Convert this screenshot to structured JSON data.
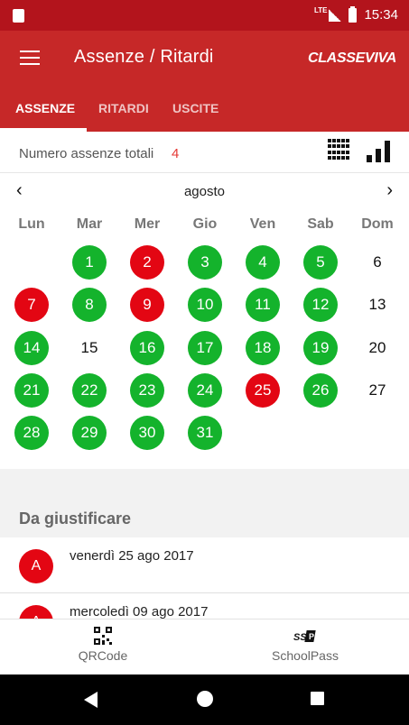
{
  "status_bar": {
    "network": "LTE",
    "time": "15:34"
  },
  "app_bar": {
    "title": "Assenze / Ritardi",
    "logo": "CLASSEVIVA"
  },
  "tabs": [
    {
      "label": "ASSENZE",
      "active": true
    },
    {
      "label": "RITARDI",
      "active": false
    },
    {
      "label": "USCITE",
      "active": false
    }
  ],
  "totals": {
    "label": "Numero assenze totali",
    "count": "4"
  },
  "calendar": {
    "month": "agosto",
    "weekdays": [
      "Lun",
      "Mar",
      "Mer",
      "Gio",
      "Ven",
      "Sab",
      "Dom"
    ],
    "days": [
      {
        "n": "1",
        "status": "green"
      },
      {
        "n": "2",
        "status": "red"
      },
      {
        "n": "3",
        "status": "green"
      },
      {
        "n": "4",
        "status": "green"
      },
      {
        "n": "5",
        "status": "green"
      },
      {
        "n": "6",
        "status": "none"
      },
      {
        "n": "7",
        "status": "red"
      },
      {
        "n": "8",
        "status": "green"
      },
      {
        "n": "9",
        "status": "red"
      },
      {
        "n": "10",
        "status": "green"
      },
      {
        "n": "11",
        "status": "green"
      },
      {
        "n": "12",
        "status": "green"
      },
      {
        "n": "13",
        "status": "none"
      },
      {
        "n": "14",
        "status": "green"
      },
      {
        "n": "15",
        "status": "none"
      },
      {
        "n": "16",
        "status": "green"
      },
      {
        "n": "17",
        "status": "green"
      },
      {
        "n": "18",
        "status": "green"
      },
      {
        "n": "19",
        "status": "green"
      },
      {
        "n": "20",
        "status": "none"
      },
      {
        "n": "21",
        "status": "green"
      },
      {
        "n": "22",
        "status": "green"
      },
      {
        "n": "23",
        "status": "green"
      },
      {
        "n": "24",
        "status": "green"
      },
      {
        "n": "25",
        "status": "red"
      },
      {
        "n": "26",
        "status": "green"
      },
      {
        "n": "27",
        "status": "none"
      },
      {
        "n": "28",
        "status": "green"
      },
      {
        "n": "29",
        "status": "green"
      },
      {
        "n": "30",
        "status": "green"
      },
      {
        "n": "31",
        "status": "green"
      }
    ]
  },
  "da_giustificare": {
    "title": "Da giustificare",
    "items": [
      {
        "badge": "A",
        "date": "venerdì 25 ago 2017"
      },
      {
        "badge": "A",
        "date": "mercoledì 09 ago 2017"
      }
    ]
  },
  "bottom_nav": [
    {
      "label": "QRCode",
      "icon": "qrcode-icon"
    },
    {
      "label": "SchoolPass",
      "icon": "schoolpass-icon"
    }
  ],
  "colors": {
    "primary": "#c62828",
    "status_bar": "#b3141c",
    "present": "#14b32c",
    "absent": "#e30613"
  }
}
